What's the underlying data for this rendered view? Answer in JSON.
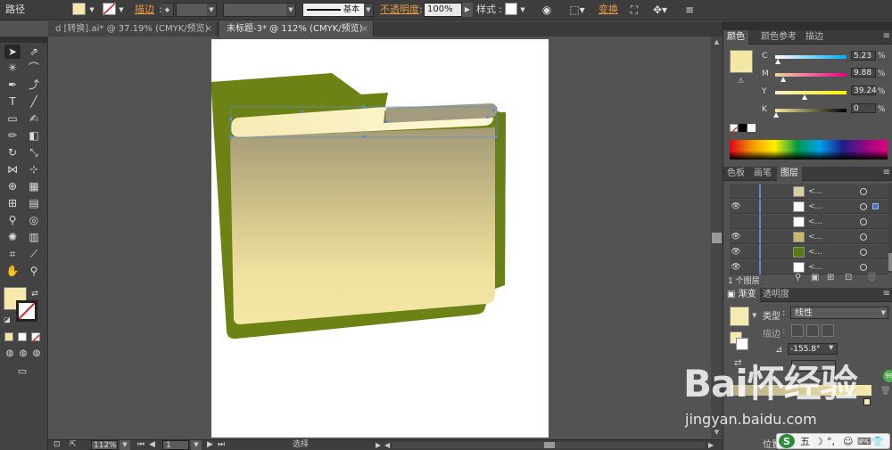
{
  "control_bar": {
    "type_label": "路径",
    "stroke_label": "描边",
    "stroke_profile": "基本",
    "opacity_label": "不透明度",
    "opacity_value": "100%",
    "style_label": "样式",
    "transform_label": "变换",
    "fill_color": "#f6e8a8"
  },
  "tabs": [
    {
      "label": "d [转换].ai* @ 37.19% (CMYK/预览)"
    },
    {
      "label": "未标题-3* @ 112% (CMYK/预览)"
    }
  ],
  "status_bar": {
    "zoom": "112%",
    "page": "1",
    "tool": "选择"
  },
  "color_panel": {
    "tabs": [
      "颜色",
      "颜色参考",
      "描边"
    ],
    "channels": [
      {
        "label": "C",
        "value": "5.23",
        "percent": 5.23
      },
      {
        "label": "M",
        "value": "9.88",
        "percent": 9.88
      },
      {
        "label": "Y",
        "value": "39.24",
        "percent": 39.24
      },
      {
        "label": "K",
        "value": "0",
        "percent": 0
      }
    ],
    "swatch_color": "#f3e8a3"
  },
  "layers_panel": {
    "tabs": [
      "色板",
      "画笔",
      "图层"
    ],
    "footer": "1 个图层",
    "rows": [
      {
        "name": "<...",
        "thumb": "#d6cfa0"
      },
      {
        "name": "<...",
        "thumb": "#ffffff"
      },
      {
        "name": "<...",
        "thumb": "#ffffff"
      },
      {
        "name": "<...",
        "thumb": "#c8b86a"
      },
      {
        "name": "<...",
        "thumb": "#5a7a12"
      },
      {
        "name": "<...",
        "thumb": "#ffffff"
      }
    ]
  },
  "gradient_panel": {
    "tabs": [
      "渐变",
      "透明度"
    ],
    "type_label": "类型",
    "type_value": "线性",
    "stroke_label": "描边",
    "angle_value": "-155.8°",
    "location_label": "位置"
  },
  "watermark": {
    "brand": "Bai怀经验",
    "url": "jingyan.baidu.com"
  },
  "ime": {
    "mode": "五"
  }
}
